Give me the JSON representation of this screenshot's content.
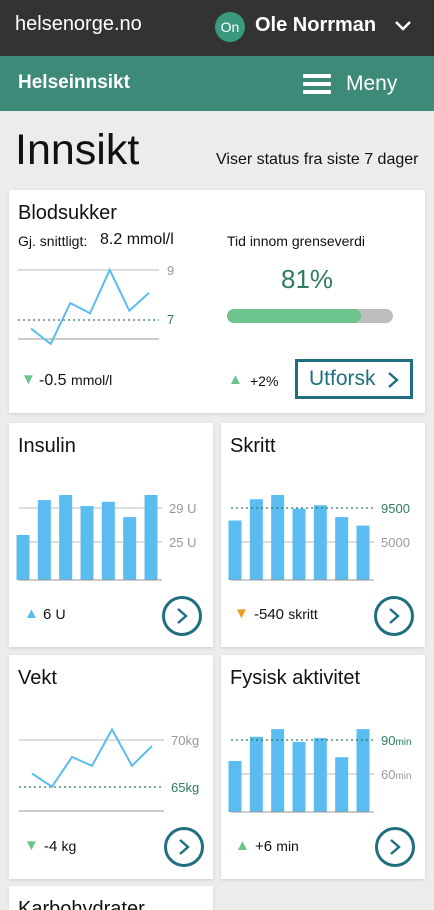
{
  "header": {
    "site": "helsenorge.no",
    "avatar_initials": "On",
    "user_name": "Ole Norrman"
  },
  "nav": {
    "brand": "Helseinnsikt",
    "menu_label": "Meny"
  },
  "page": {
    "title": "Innsikt",
    "status": "Viser status fra siste 7 dager"
  },
  "colors": {
    "topbar": "#333333",
    "nav": "#3d8a78",
    "accent": "#1f6f80",
    "chart_blue": "#5bbcf0",
    "target_green": "#2e7d5e"
  },
  "cards": {
    "blood_sugar": {
      "title": "Blodsukker",
      "avg_label": "Gj. snittligt:",
      "avg_value": "8.2 mmol/l",
      "range_label": "Tid innom grenseverdi",
      "range_value": "81%",
      "range_fraction": 0.81,
      "trend_left_value": "-0.5",
      "trend_left_unit": "mmol/l",
      "trend_right": "+2%",
      "explore_label": "Utforsk",
      "axis_high": "9",
      "axis_target": "7"
    },
    "insulin": {
      "title": "Insulin",
      "trend_value": "6",
      "trend_unit": "U",
      "axis_high": "29 U",
      "axis_low": "25 U"
    },
    "steps": {
      "title": "Skritt",
      "trend_value": "-540",
      "trend_unit": "skritt",
      "axis_target": "9500",
      "axis_low": "5000"
    },
    "weight": {
      "title": "Vekt",
      "trend_value": "-4",
      "trend_unit": "kg",
      "axis_high": "70kg",
      "axis_target": "65kg"
    },
    "activity": {
      "title": "Fysisk aktivitet",
      "trend_value": "+6",
      "trend_unit": "min",
      "axis_target_num": "90",
      "axis_target_unit": "min",
      "axis_low_num": "60",
      "axis_low_unit": "min"
    },
    "carbs": {
      "title": "Karbohydrater"
    }
  },
  "chart_data": [
    {
      "type": "line",
      "title": "Blodsukker",
      "x": [
        1,
        2,
        3,
        4,
        5,
        6,
        7
      ],
      "values": [
        9.0,
        9.6,
        8.0,
        8.4,
        6.7,
        8.3,
        7.6
      ],
      "ylim": [
        6.0,
        9.8
      ],
      "reference_lines": [
        9,
        7
      ]
    },
    {
      "type": "bar",
      "title": "Insulin",
      "x": [
        1,
        2,
        3,
        4,
        5,
        6,
        7
      ],
      "values": [
        25.8,
        29.9,
        30.5,
        29.2,
        29.7,
        27.9,
        30.5
      ],
      "ylim": [
        20.5,
        32.5
      ],
      "reference_lines": [
        29,
        25
      ]
    },
    {
      "type": "bar",
      "title": "Skritt",
      "x": [
        1,
        2,
        3,
        4,
        5,
        6,
        7
      ],
      "values": [
        8000,
        10500,
        11000,
        9400,
        9800,
        8400,
        7400
      ],
      "ylim": [
        1000,
        13000
      ],
      "reference_lines": [
        9500,
        5000
      ]
    },
    {
      "type": "line",
      "title": "Vekt",
      "x": [
        1,
        2,
        3,
        4,
        5,
        6,
        7
      ],
      "values": [
        67.5,
        66.3,
        69.0,
        68.2,
        71.5,
        68.2,
        70.0
      ],
      "ylim": [
        62.0,
        73.0
      ],
      "reference_lines": [
        70,
        65
      ]
    },
    {
      "type": "bar",
      "title": "Fysisk aktivitet",
      "x": [
        1,
        2,
        3,
        4,
        5,
        6,
        7
      ],
      "values": [
        70,
        89,
        95,
        85,
        88,
        73,
        95
      ],
      "ylim": [
        30,
        110
      ],
      "reference_lines": [
        90,
        60
      ]
    }
  ]
}
